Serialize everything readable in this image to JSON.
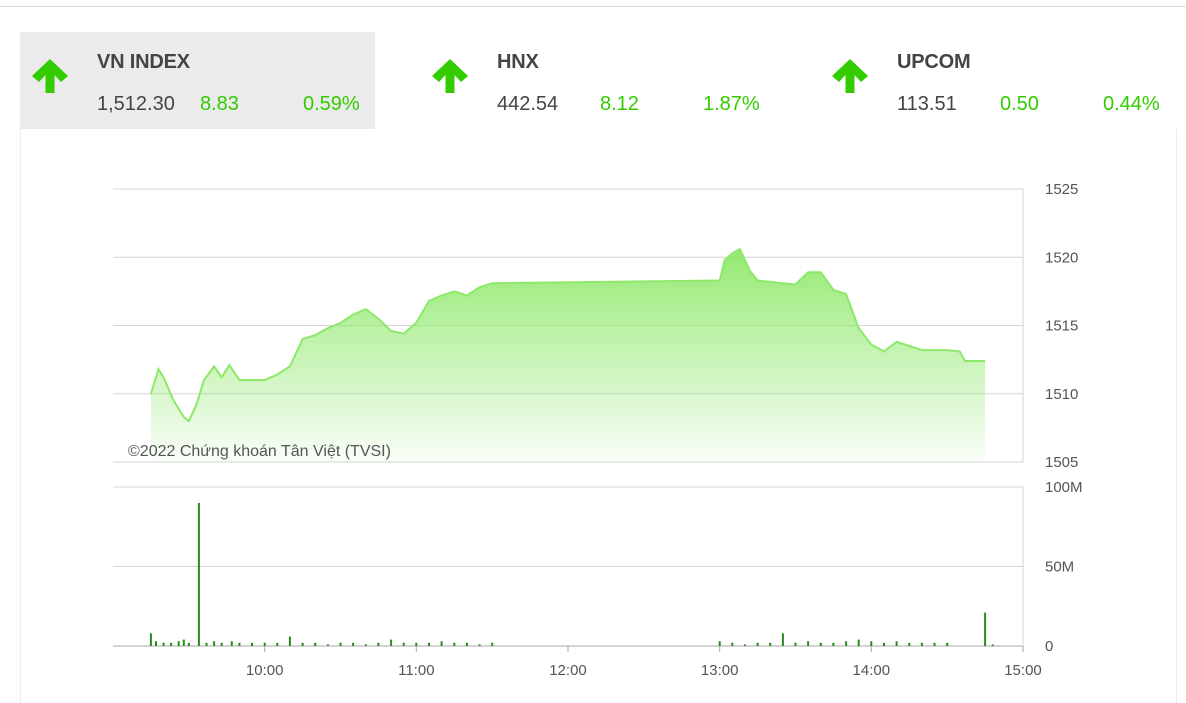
{
  "tiles": [
    {
      "name": "VN INDEX",
      "price": "1,512.30",
      "change": "8.83",
      "percent": "0.59%",
      "icon": "arrow-up-icon",
      "active": true
    },
    {
      "name": "HNX",
      "price": "442.54",
      "change": "8.12",
      "percent": "1.87%",
      "icon": "arrow-up-icon",
      "active": false
    },
    {
      "name": "UPCOM",
      "price": "113.51",
      "change": "0.50",
      "percent": "0.44%",
      "icon": "arrow-up-icon",
      "active": false
    }
  ],
  "colors": {
    "up": "#33cc00",
    "line": "#8ee86a",
    "volume": "#2a8a1e",
    "grid": "#d6d6d6"
  },
  "chart_data": {
    "type": "area",
    "copyright": "©2022 Chứng khoán Tân Việt (TVSI)",
    "price": {
      "yticks": [
        "1525",
        "1520",
        "1515",
        "1510",
        "1505"
      ],
      "ylim": [
        1505,
        1525
      ],
      "points": [
        [
          "09:15",
          1510.0
        ],
        [
          "09:18",
          1511.8
        ],
        [
          "09:20",
          1511.2
        ],
        [
          "09:24",
          1509.5
        ],
        [
          "09:28",
          1508.3
        ],
        [
          "09:30",
          1508.0
        ],
        [
          "09:33",
          1509.2
        ],
        [
          "09:36",
          1511.0
        ],
        [
          "09:40",
          1512.0
        ],
        [
          "09:43",
          1511.2
        ],
        [
          "09:46",
          1512.1
        ],
        [
          "09:50",
          1511.0
        ],
        [
          "09:55",
          1511.0
        ],
        [
          "10:00",
          1511.0
        ],
        [
          "10:05",
          1511.4
        ],
        [
          "10:10",
          1512.0
        ],
        [
          "10:15",
          1514.0
        ],
        [
          "10:20",
          1514.3
        ],
        [
          "10:25",
          1514.8
        ],
        [
          "10:30",
          1515.2
        ],
        [
          "10:35",
          1515.8
        ],
        [
          "10:40",
          1516.2
        ],
        [
          "10:45",
          1515.5
        ],
        [
          "10:50",
          1514.6
        ],
        [
          "10:55",
          1514.4
        ],
        [
          "11:00",
          1515.2
        ],
        [
          "11:05",
          1516.8
        ],
        [
          "11:10",
          1517.2
        ],
        [
          "11:15",
          1517.5
        ],
        [
          "11:20",
          1517.2
        ],
        [
          "11:25",
          1517.8
        ],
        [
          "11:30",
          1518.1
        ],
        [
          "13:00",
          1518.3
        ],
        [
          "13:02",
          1519.8
        ],
        [
          "13:05",
          1520.3
        ],
        [
          "13:08",
          1520.6
        ],
        [
          "13:12",
          1519.0
        ],
        [
          "13:15",
          1518.3
        ],
        [
          "13:20",
          1518.2
        ],
        [
          "13:25",
          1518.1
        ],
        [
          "13:30",
          1518.0
        ],
        [
          "13:35",
          1518.9
        ],
        [
          "13:40",
          1518.9
        ],
        [
          "13:45",
          1517.6
        ],
        [
          "13:50",
          1517.3
        ],
        [
          "13:55",
          1514.8
        ],
        [
          "14:00",
          1513.6
        ],
        [
          "14:05",
          1513.1
        ],
        [
          "14:10",
          1513.8
        ],
        [
          "14:15",
          1513.5
        ],
        [
          "14:20",
          1513.2
        ],
        [
          "14:30",
          1513.2
        ],
        [
          "14:35",
          1513.1
        ],
        [
          "14:37",
          1512.4
        ],
        [
          "14:45",
          1512.4
        ]
      ]
    },
    "volume": {
      "yticks": [
        "100M",
        "50M",
        "0"
      ],
      "ylim": [
        0,
        100
      ],
      "unit": "M",
      "bars": [
        [
          "09:15",
          8
        ],
        [
          "09:17",
          3
        ],
        [
          "09:20",
          2
        ],
        [
          "09:23",
          2
        ],
        [
          "09:26",
          3
        ],
        [
          "09:28",
          4
        ],
        [
          "09:30",
          2
        ],
        [
          "09:34",
          90
        ],
        [
          "09:37",
          2
        ],
        [
          "09:40",
          3
        ],
        [
          "09:43",
          2
        ],
        [
          "09:47",
          3
        ],
        [
          "09:50",
          2
        ],
        [
          "09:55",
          2
        ],
        [
          "10:00",
          2
        ],
        [
          "10:05",
          2
        ],
        [
          "10:10",
          6
        ],
        [
          "10:15",
          2
        ],
        [
          "10:20",
          2
        ],
        [
          "10:25",
          1
        ],
        [
          "10:30",
          2
        ],
        [
          "10:35",
          2
        ],
        [
          "10:40",
          1
        ],
        [
          "10:45",
          2
        ],
        [
          "10:50",
          4
        ],
        [
          "10:55",
          2
        ],
        [
          "11:00",
          2
        ],
        [
          "11:05",
          2
        ],
        [
          "11:10",
          3
        ],
        [
          "11:15",
          2
        ],
        [
          "11:20",
          2
        ],
        [
          "11:25",
          1
        ],
        [
          "11:30",
          2
        ],
        [
          "13:00",
          3
        ],
        [
          "13:05",
          2
        ],
        [
          "13:10",
          1
        ],
        [
          "13:15",
          2
        ],
        [
          "13:20",
          2
        ],
        [
          "13:25",
          8
        ],
        [
          "13:30",
          2
        ],
        [
          "13:35",
          3
        ],
        [
          "13:40",
          2
        ],
        [
          "13:45",
          2
        ],
        [
          "13:50",
          3
        ],
        [
          "13:55",
          4
        ],
        [
          "14:00",
          3
        ],
        [
          "14:05",
          2
        ],
        [
          "14:10",
          3
        ],
        [
          "14:15",
          2
        ],
        [
          "14:20",
          2
        ],
        [
          "14:25",
          2
        ],
        [
          "14:30",
          2
        ],
        [
          "14:45",
          21
        ],
        [
          "14:48",
          1
        ]
      ]
    },
    "xticks": [
      "10:00",
      "11:00",
      "12:00",
      "13:00",
      "14:00",
      "15:00"
    ]
  }
}
